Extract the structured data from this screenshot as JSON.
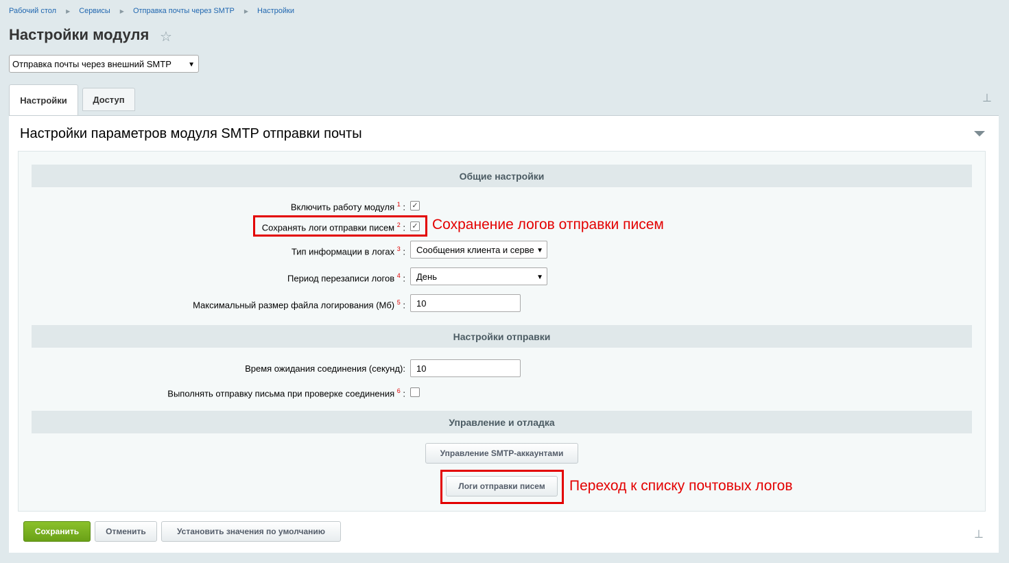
{
  "breadcrumb": [
    "Рабочий стол",
    "Сервисы",
    "Отправка почты через SMTP",
    "Настройки"
  ],
  "page_title": "Настройки модуля",
  "module_select": "Отправка почты через внешний SMTP",
  "tabs": [
    "Настройки",
    "Доступ"
  ],
  "panel_title": "Настройки параметров модуля SMTP отправки почты",
  "sections": {
    "general": "Общие настройки",
    "send": "Настройки отправки",
    "debug": "Управление и отладка"
  },
  "rows": {
    "enable": {
      "label": "Включить работу модуля",
      "note": "1",
      "checked": true
    },
    "save_logs": {
      "label": "Сохранять логи отправки писем",
      "note": "2",
      "checked": true
    },
    "log_type": {
      "label": "Тип информации в логах",
      "note": "3",
      "value": "Сообщения клиента и серве"
    },
    "log_period": {
      "label": "Период перезаписи логов",
      "note": "4",
      "value": "День"
    },
    "log_size": {
      "label": "Максимальный размер файла логирования (Мб)",
      "note": "5",
      "value": "10"
    },
    "timeout": {
      "label": "Время ожидания соединения (секунд):",
      "value": "10"
    },
    "test_send": {
      "label": "Выполнять отправку письма при проверке соединения",
      "note": "6",
      "checked": false
    }
  },
  "buttons": {
    "smtp_accounts": "Управление SMTP-аккаунтами",
    "mail_logs": "Логи отправки писем",
    "save": "Сохранить",
    "cancel": "Отменить",
    "defaults": "Установить значения по умолчанию"
  },
  "annotations": {
    "save_logs": "Сохранение логов отправки писем",
    "mail_logs": "Переход к списку почтовых логов"
  },
  "colors": {
    "annotation": "#e30000",
    "save_button": "#7ab220",
    "link": "#2067b0"
  }
}
